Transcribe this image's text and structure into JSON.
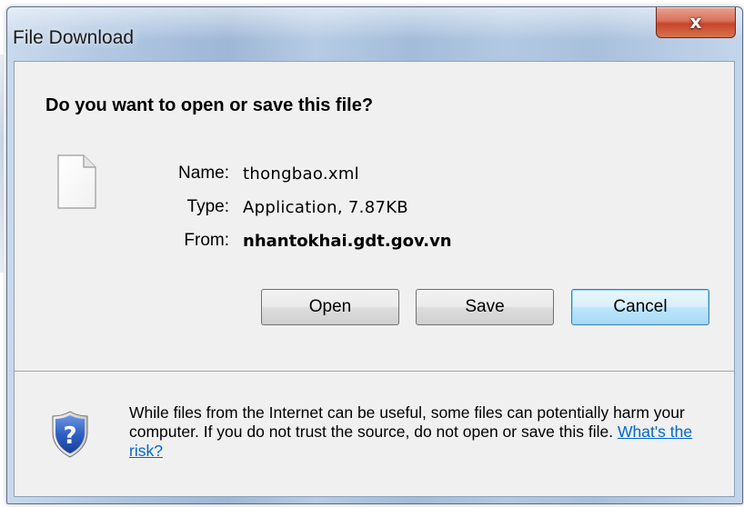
{
  "window": {
    "title": "File Download",
    "close_symbol": "x"
  },
  "question": "Do you want to open or save this file?",
  "file": {
    "icon": "blank-file-icon",
    "name_label": "Name:",
    "name_value": "thongbao.xml",
    "type_label": "Type:",
    "type_value": "Application, 7.87KB",
    "from_label": "From:",
    "from_value": "nhantokhai.gdt.gov.vn"
  },
  "buttons": {
    "open": "Open",
    "save": "Save",
    "cancel": "Cancel"
  },
  "warning": {
    "icon": "shield-question-icon",
    "text": "While files from the Internet can be useful, some files can potentially harm your computer. If you do not trust the source, do not open or save this file.",
    "link": "What's the risk?"
  },
  "colors": {
    "link": "#0066cc",
    "close_button": "#c7452b",
    "default_button_border": "#3c7fb1",
    "dialog_background": "#f0f0f0"
  }
}
